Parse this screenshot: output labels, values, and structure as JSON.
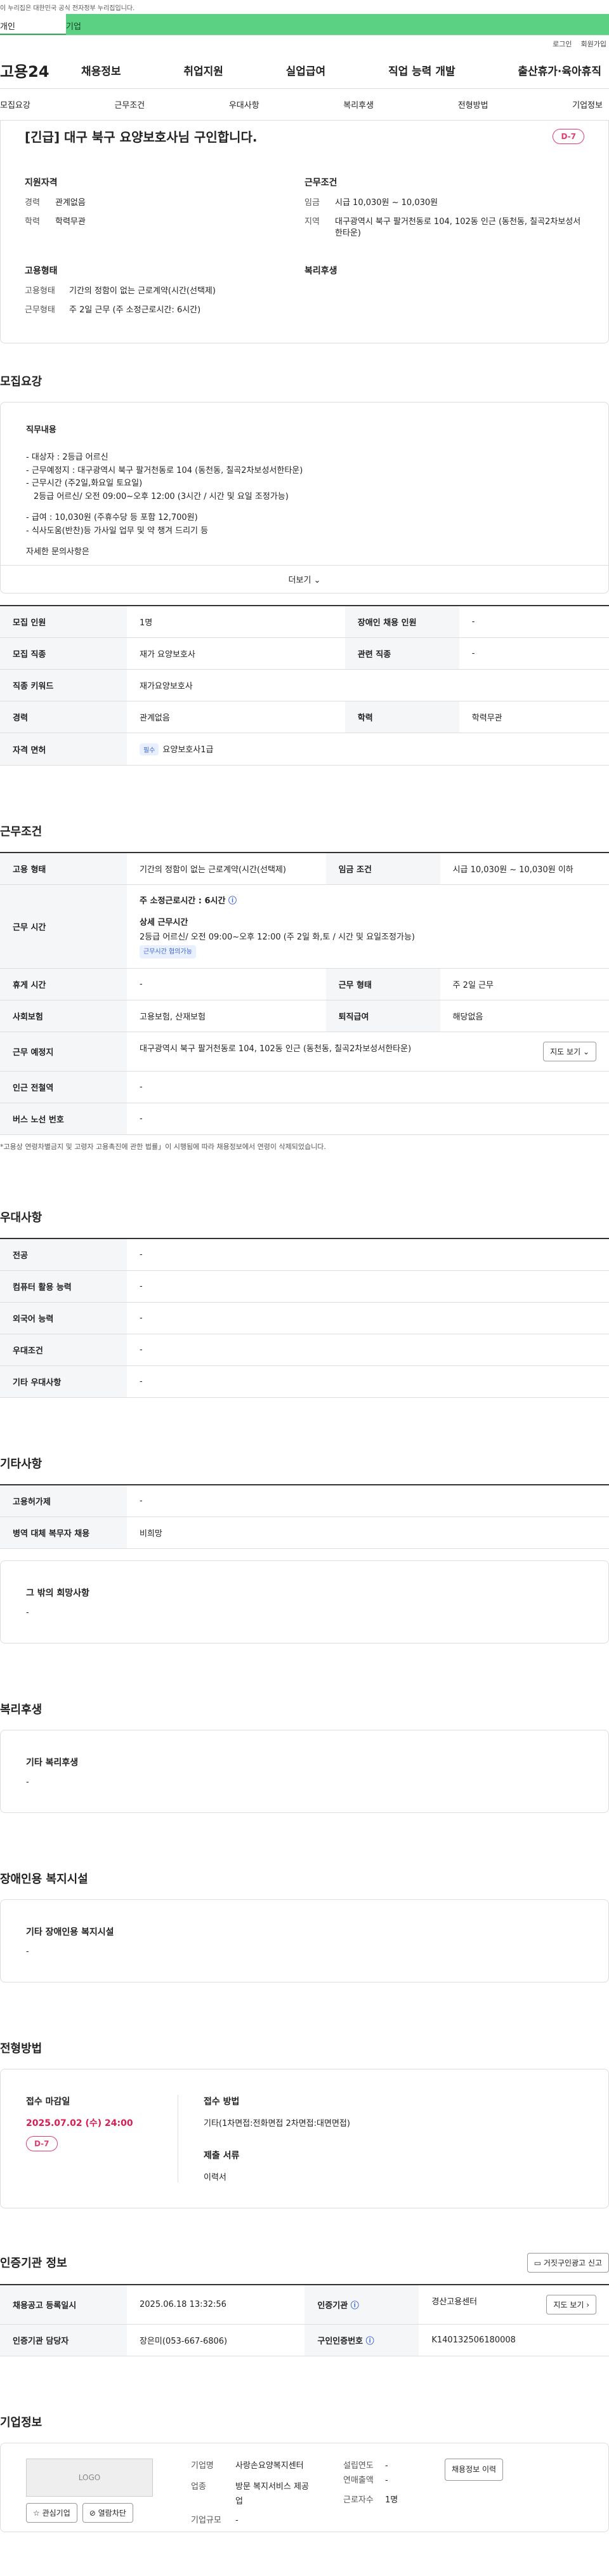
{
  "gov": "이 누리집은 대한민국 공식 전자정부 누리집입니다.",
  "tabs": [
    "개인",
    "기업"
  ],
  "util": [
    "로그인",
    "회원가입"
  ],
  "logo": "고용24",
  "gnb": [
    "채용정보",
    "취업지원",
    "실업급여",
    "직업 능력 개발",
    "출산휴가·육아휴직"
  ],
  "snb": [
    "모집요강",
    "근무조건",
    "우대사항",
    "복리후생",
    "전형방법",
    "기업정보"
  ],
  "summary": {
    "title": "[긴급] 대구 북구 요양보호사님 구인합니다.",
    "dday": "D-7",
    "qual_h": "지원자격",
    "cond_h": "근무조건",
    "type_h": "고용형태",
    "welfare_h": "복리후생",
    "qual": [
      {
        "k": "경력",
        "v": "관계없음"
      },
      {
        "k": "학력",
        "v": "학력무관"
      }
    ],
    "cond": [
      {
        "k": "임금",
        "v": "시급 10,030원 ~ 10,030원"
      },
      {
        "k": "지역",
        "v": "대구광역시 북구 팔거천동로 104, 102동 인근 (동천동, 칠곡2차보성서한타운)"
      }
    ],
    "type": [
      {
        "k": "고용형태",
        "v": "기간의 정함이 없는 근로계약(시간(선택제)"
      },
      {
        "k": "근무형태",
        "v": "주 2일 근무 (주 소정근로시간: 6시간)"
      }
    ]
  },
  "recruit": {
    "title": "모집요강",
    "desc_h": "직무내용",
    "desc": [
      "- 대상자 : 2등급 어르신",
      "- 근무예정지 : 대구광역시 북구 팔거천동로 104 (동천동, 칠곡2차보성서한타운)",
      "- 근무시간 (주2일,화요일 토요일)",
      "  2등급 어르신/ 오전 09:00~오후 12:00 (3시간 / 시간 및 요일 조정가능)",
      "",
      "- 급여 : 10,030원 (주휴수당 등 포함 12,700원)",
      "- 식사도움(반찬)등 가사일 업무 및 약 챙겨 드리기 등",
      "",
      "자세한 문의사항은"
    ],
    "more": "더보기",
    "rows": [
      [
        "모집 인원",
        "1명",
        "장애인 채용 인원",
        "-"
      ],
      [
        "모집 직종",
        "재가 요양보호사",
        "관련 직종",
        "-"
      ]
    ],
    "kw_k": "직종 키워드",
    "kw_v": "재가요양보호사",
    "edu": [
      "경력",
      "관계없음",
      "학력",
      "학력무관"
    ],
    "lic_k": "자격 면허",
    "lic_chip": "필수",
    "lic_v": "요양보호사1급"
  },
  "work": {
    "title": "근무조건",
    "r1": [
      "고용 형태",
      "기간의 정함이 없는 근로계약(시간(선택제)",
      "임금 조건",
      "시급 10,030원 ~ 10,030원 이하"
    ],
    "time_k": "근무 시간",
    "time_main": "주 소정근로시간 : 6시간",
    "time_sub_h": "상세 근무시간",
    "time_sub": "2등급 어르신/ 오전 09:00~오후 12:00 (주 2일 화,토 / 시간 및 요일조정가능)",
    "time_chip": "근무시간 협의가능",
    "r2": [
      "휴게 시간",
      "-",
      "근무 형태",
      "주 2일 근무"
    ],
    "r3": [
      "사회보험",
      "고용보험, 산재보험",
      "퇴직급여",
      "해당없음"
    ],
    "place_k": "근무 예정지",
    "place_v": "대구광역시 북구 팔거천동로 104, 102동 인근 (동천동, 칠곡2차보성서한타운)",
    "map": "지도 보기",
    "sub_k": "인근 전철역",
    "bus_k": "버스 노선 번호",
    "note": "*고용상 연령차별금지 및 고령자 고용촉진에 관한 법률」이 시행됨에 따라 채용정보에서 연령이 삭제되었습니다."
  },
  "pref": {
    "title": "우대사항",
    "rows": [
      "전공",
      "컴퓨터 활용 능력",
      "외국어 능력",
      "우대조건",
      "기타 우대사항"
    ]
  },
  "etc": {
    "title": "기타사항",
    "r1k": "고용허가제",
    "r2k": "병역 대체 복무자 채용",
    "r2v": "비희망",
    "box_h": "그 밖의 희망사항"
  },
  "welfare": {
    "title": "복리후생",
    "box_h": "기타 복리후생"
  },
  "disabled": {
    "title": "장애인용 복지시설",
    "box_h": "기타 장애인용 복지시설"
  },
  "selection": {
    "title": "전형방법",
    "deadline_h": "접수 마감일",
    "deadline": "2025.07.02 (수) 24:00",
    "dday": "D-7",
    "method_h": "접수 방법",
    "method": "기타(1차면접:전화면접 2차면접:대면면접)",
    "docs_h": "제출 서류",
    "docs": "이력서"
  },
  "agency": {
    "title": "인증기관 정보",
    "report": "거짓구인광고 신고",
    "r1": [
      "채용공고 등록일시",
      "2025.06.18 13:32:56",
      "인증기관",
      "경산고용센터"
    ],
    "r2": [
      "인증기관 담당자",
      "장은미(053-667-6806)",
      "구인인증번호",
      "K140132506180008"
    ],
    "map": "지도 보기"
  },
  "company": {
    "title": "기업정보",
    "logo": "LOGO",
    "fav": "관심기업",
    "block": "열람차단",
    "k1": "기업명",
    "v1": "사랑손요양복지센터",
    "k2": "설립연도",
    "v2": "-",
    "k3": "연매출액",
    "v3": "-",
    "k4": "업종",
    "v4": "방문 복지서비스 제공업",
    "k5": "근로자수",
    "v5": "1명",
    "k6": "기업규모",
    "v6": "-",
    "btn": "채용정보 이력"
  }
}
